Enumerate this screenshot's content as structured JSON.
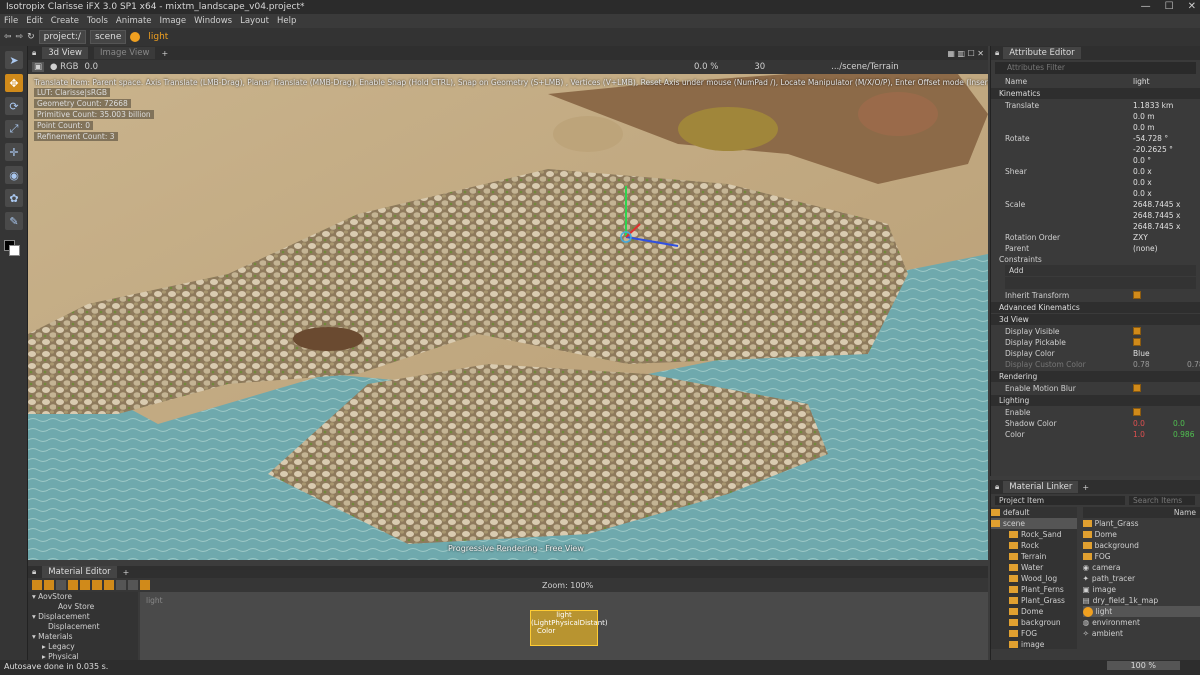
{
  "window": {
    "title": "Isotropix Clarisse iFX 3.0 SP1 x64 - mixtm_landscape_v04.project*"
  },
  "menu": [
    "File",
    "Edit",
    "Create",
    "Tools",
    "Animate",
    "Image",
    "Windows",
    "Layout",
    "Help"
  ],
  "path": {
    "root": "project:/",
    "scene": "scene",
    "current": "light"
  },
  "viewport": {
    "tabs": [
      "3d View",
      "Image View"
    ],
    "toolbar": {
      "zoom_value": "0.0",
      "percent": "0.0 %",
      "frame": "30",
      "terrain_path": ".../scene/Terrain"
    },
    "hint": "Translate Item: Parent space. Axis Translate (LMB-Drag), Planar Translate (MMB-Drag), Enable Snap (Hold CTRL), Snap on Geometry (S+LMB) , Vertices (V+LMB), Reset Axis under mouse (NumPad /), Locate Manipulator (M/X/O/P), Enter Offset mode (Insert)",
    "stats": [
      "LUT: Clarisse|sRGB",
      "Geometry Count: 72668",
      "Primitive Count: 35.003 billion",
      "Point Count: 0",
      "Refinement Count: 3"
    ],
    "progress": "Progressive Rendering - Free View"
  },
  "attribute_editor": {
    "title": "Attribute Editor",
    "filter_placeholder": "Attributes Filter",
    "name_label": "Name",
    "name_value": "light",
    "sections": {
      "kinematics": "Kinematics",
      "advanced": "Advanced Kinematics",
      "view3d": "3d View",
      "rendering": "Rendering",
      "lighting": "Lighting"
    },
    "translate": {
      "label": "Translate",
      "x": "1.1833 km",
      "y": "0.0 m",
      "z": "0.0 m"
    },
    "rotate": {
      "label": "Rotate",
      "x": "-54.728 °",
      "y": "-20.2625 °",
      "z": "0.0 °"
    },
    "shear": {
      "label": "Shear",
      "x": "0.0 x",
      "y": "0.0 x",
      "z": "0.0 x"
    },
    "scale": {
      "label": "Scale",
      "x": "2648.7445 x",
      "y": "2648.7445 x",
      "z": "2648.7445 x"
    },
    "rotation_order": {
      "label": "Rotation Order",
      "value": "ZXY"
    },
    "parent": {
      "label": "Parent",
      "value": "(none)"
    },
    "constraints": {
      "label": "Constraints",
      "add": "Add"
    },
    "inherit_transform": "Inherit Transform",
    "display_visible": "Display Visible",
    "display_pickable": "Display Pickable",
    "display_color": {
      "label": "Display Color",
      "value": "Blue"
    },
    "display_custom_color": {
      "label": "Display Custom Color",
      "a": "0.78",
      "b": "0.78"
    },
    "motion_blur": "Enable Motion Blur",
    "enable": "Enable",
    "shadow_color": {
      "label": "Shadow Color",
      "a": "0.0",
      "b": "0.0"
    },
    "color": {
      "label": "Color",
      "a": "1.0",
      "b": "0.986"
    }
  },
  "material_editor": {
    "title": "Material Editor",
    "zoom": "Zoom: 100%",
    "graph_label": "light",
    "tree": [
      "AovStore",
      "Aov Store",
      "Displacement",
      "Displacement",
      "Materials",
      "Legacy",
      "Physical"
    ],
    "node": {
      "title": "light",
      "type": "(LightPhysicalDistant)",
      "port": "Color"
    }
  },
  "material_linker": {
    "title": "Material Linker",
    "dropdown": "Project Item",
    "search_placeholder": "Search Items",
    "name_header": "Name",
    "tree": [
      "default",
      "scene",
      "Rock_Sand",
      "Rock",
      "Terrain",
      "Water",
      "Wood_log",
      "Plant_Ferns",
      "Plant_Grass",
      "Dome",
      "backgroun",
      "FOG",
      "image"
    ],
    "list": [
      "Plant_Grass",
      "Dome",
      "background",
      "FOG",
      "camera",
      "path_tracer",
      "image",
      "dry_field_1k_map",
      "light",
      "environment",
      "ambient"
    ]
  },
  "status": {
    "message": "Autosave done in 0.035 s.",
    "zoom": "100 %"
  }
}
